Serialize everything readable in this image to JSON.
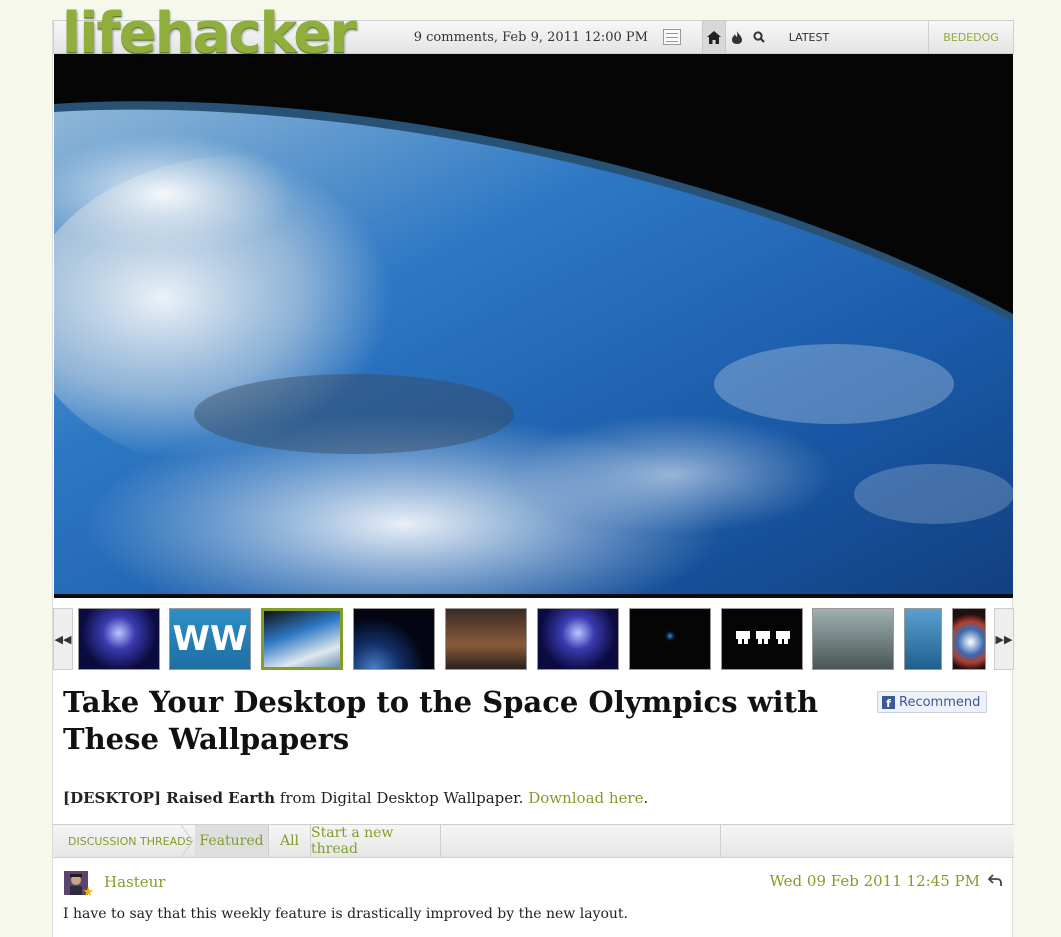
{
  "brand": {
    "logo_text": "lifehacker",
    "color": "#8fae3b"
  },
  "topbar": {
    "meta": "9 comments, Feb 9, 2011 12:00 PM",
    "icons": [
      "list-view-icon",
      "home-icon",
      "fire-icon",
      "search-icon"
    ],
    "latest_label": "LATEST",
    "user_label": "BEDEDOG"
  },
  "gallery": {
    "selected_index": 2,
    "thumbs": [
      {
        "name": "thumb-blue-moonscape"
      },
      {
        "name": "thumb-ww-logo",
        "text": "WW"
      },
      {
        "name": "thumb-raised-earth"
      },
      {
        "name": "thumb-planet-moon"
      },
      {
        "name": "thumb-city-ruins"
      },
      {
        "name": "thumb-blue-moonscape-2"
      },
      {
        "name": "thumb-tiny-earth"
      },
      {
        "name": "thumb-space-invaders"
      },
      {
        "name": "thumb-sword-city"
      },
      {
        "name": "thumb-planet-express"
      },
      {
        "name": "thumb-glowing-planet"
      }
    ]
  },
  "article": {
    "title": "Take Your Desktop to the Space Olympics with These Wallpapers",
    "recommend_label": "Recommend",
    "desc_tag": "[DESKTOP] Raised Earth",
    "desc_mid": " from Digital Desktop Wallpaper. ",
    "desc_link": "Download here",
    "desc_end": "."
  },
  "discussion": {
    "label": "DISCUSSION THREADS",
    "tabs": [
      "Featured",
      "All",
      "Start a new thread"
    ],
    "active_tab": "Featured"
  },
  "comment": {
    "author": "Hasteur",
    "date": "Wed 09 Feb 2011 12:45 PM",
    "text": "I have to say that this weekly feature is drastically improved by the new layout."
  }
}
